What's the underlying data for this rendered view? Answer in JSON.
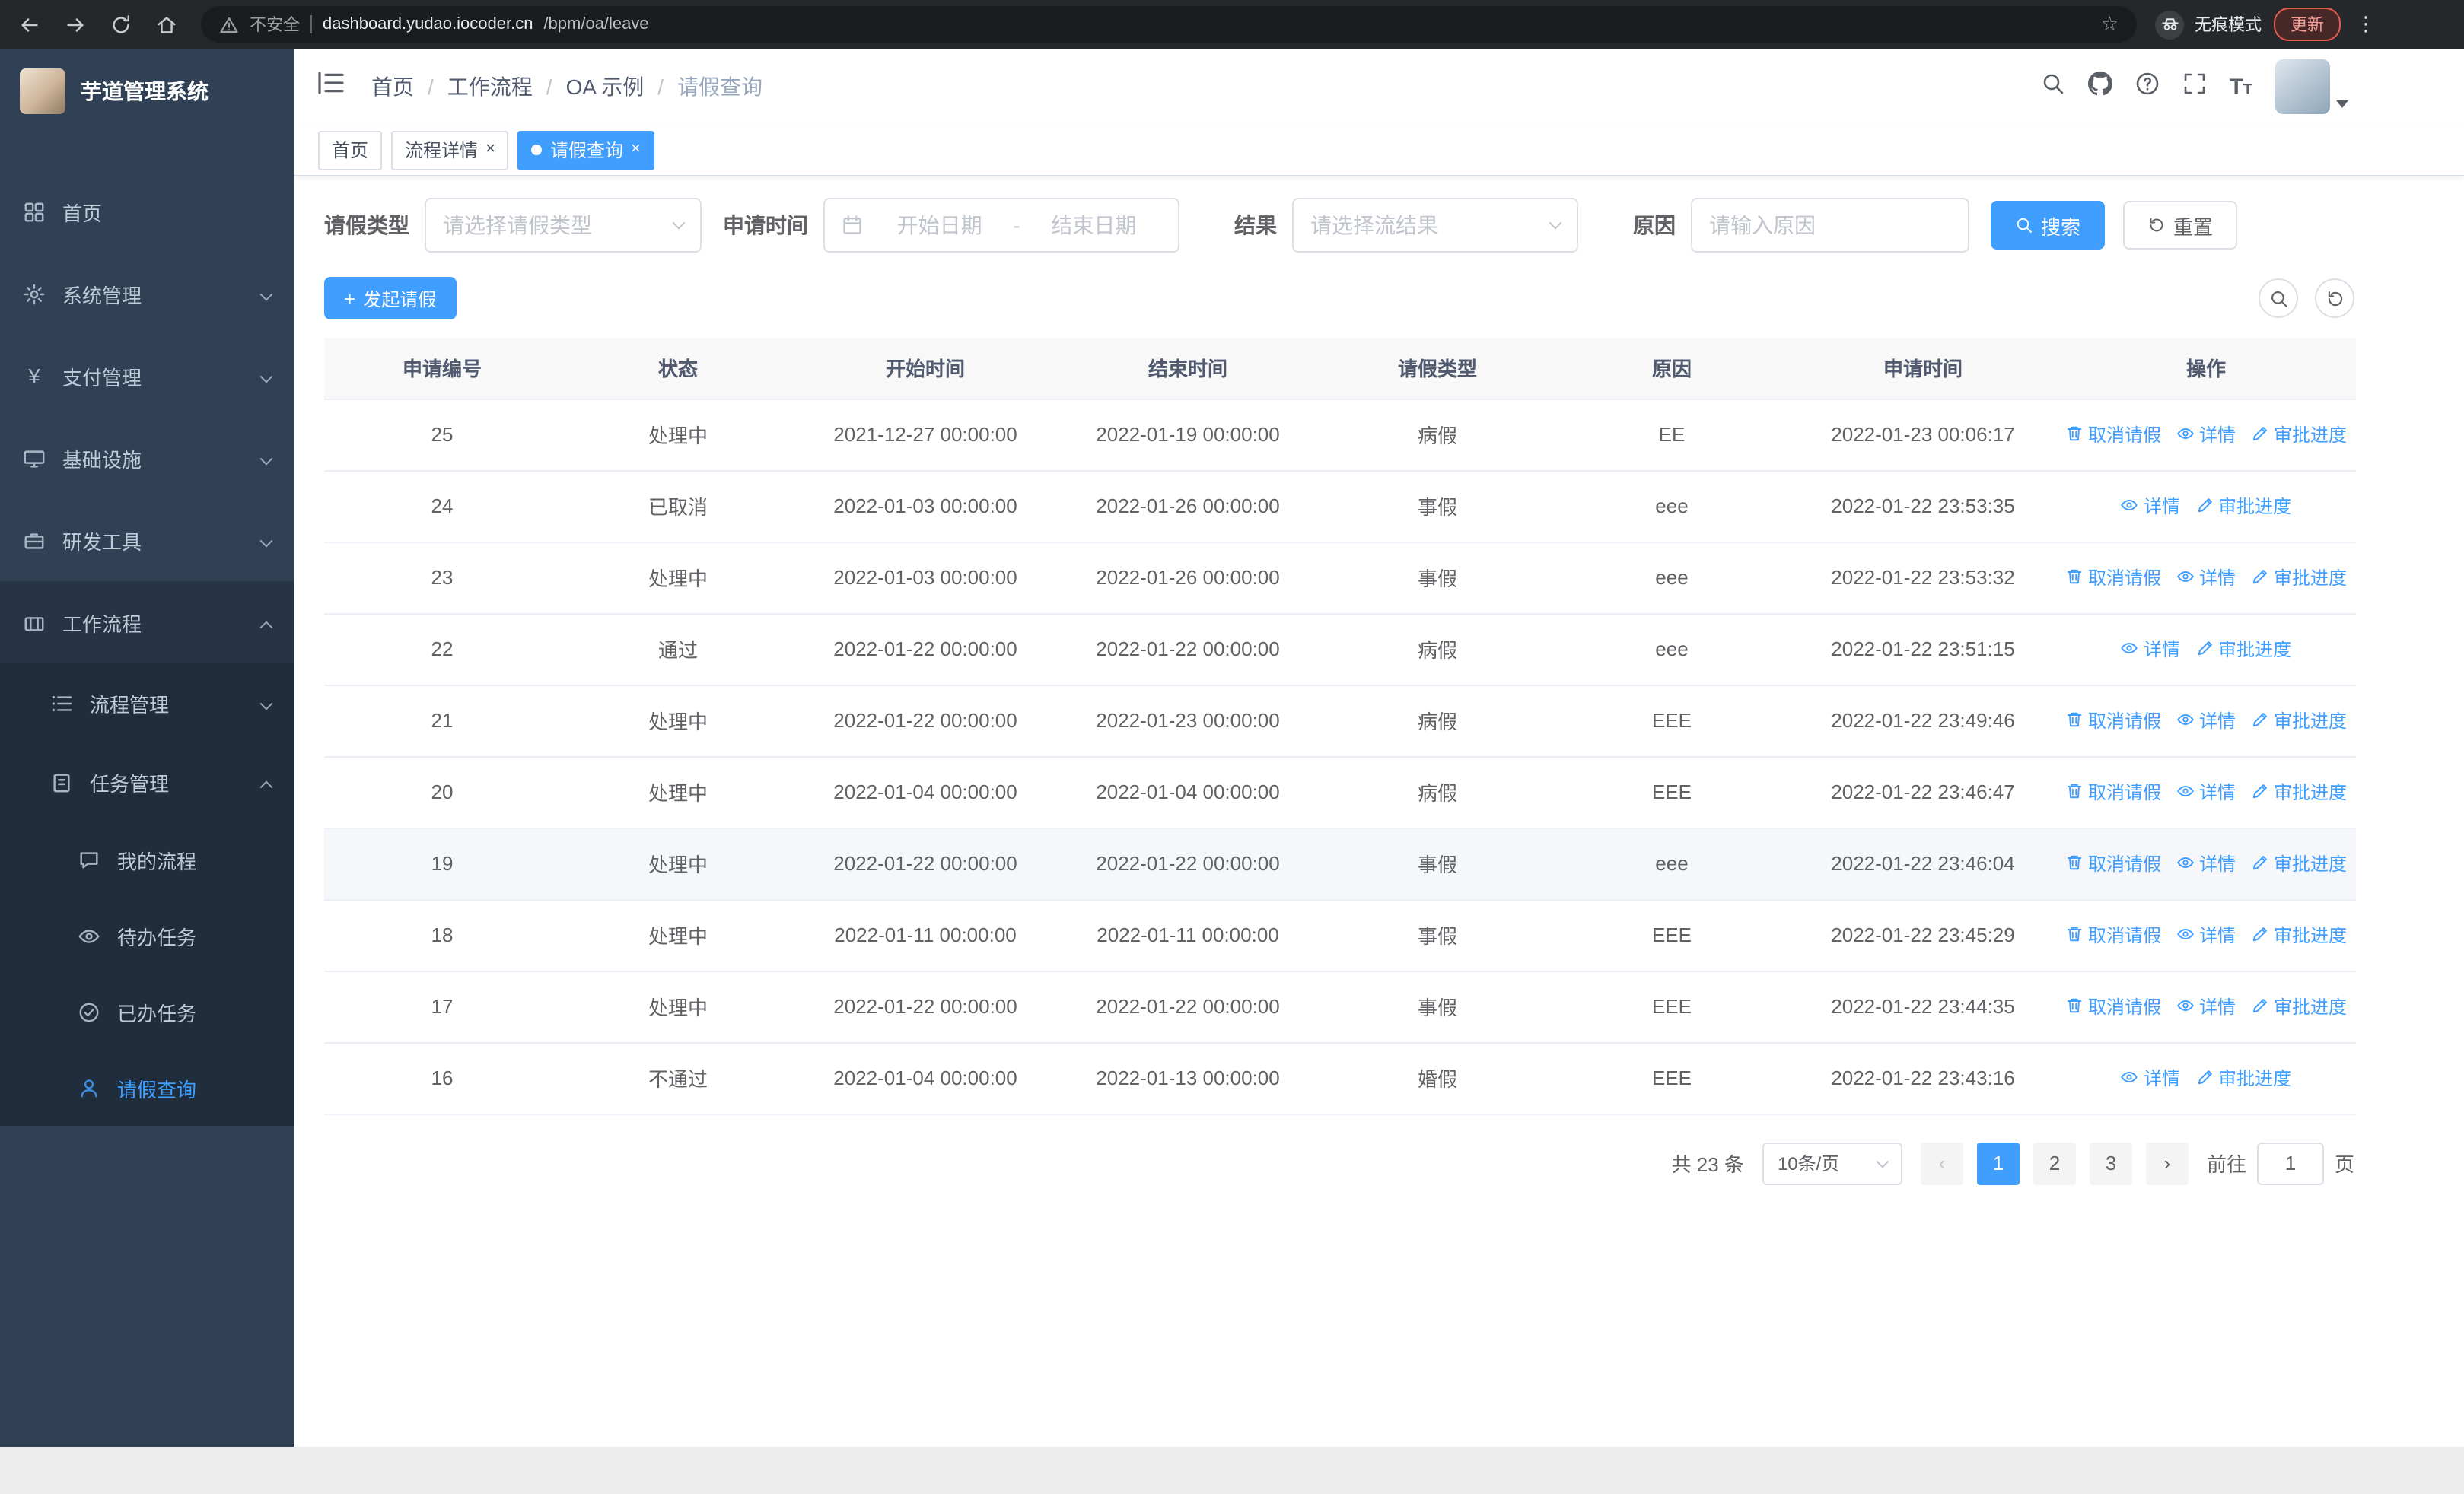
{
  "browser": {
    "security_label": "不安全",
    "url_domain": "dashboard.yudao.iocoder.cn",
    "url_path": "/bpm/oa/leave",
    "incognito_label": "无痕模式",
    "update_label": "更新"
  },
  "sidebar": {
    "app_title": "芋道管理系统",
    "items": [
      {
        "label": "首页"
      },
      {
        "label": "系统管理"
      },
      {
        "label": "支付管理"
      },
      {
        "label": "基础设施"
      },
      {
        "label": "研发工具"
      },
      {
        "label": "工作流程"
      }
    ],
    "workflow_children": [
      {
        "label": "流程管理"
      },
      {
        "label": "任务管理"
      }
    ],
    "task_children": [
      {
        "label": "我的流程"
      },
      {
        "label": "待办任务"
      },
      {
        "label": "已办任务"
      },
      {
        "label": "请假查询"
      }
    ]
  },
  "navbar": {
    "breadcrumb": [
      "首页",
      "工作流程",
      "OA 示例",
      "请假查询"
    ],
    "separator": "/"
  },
  "tabs": [
    {
      "label": "首页"
    },
    {
      "label": "流程详情"
    },
    {
      "label": "请假查询"
    }
  ],
  "filters": {
    "leave_type_label": "请假类型",
    "leave_type_placeholder": "请选择请假类型",
    "apply_time_label": "申请时间",
    "start_date_placeholder": "开始日期",
    "range_separator": "-",
    "end_date_placeholder": "结束日期",
    "result_label": "结果",
    "result_placeholder": "请选择流结果",
    "reason_label": "原因",
    "reason_placeholder": "请输入原因",
    "search_label": "搜索",
    "reset_label": "重置"
  },
  "toolbar": {
    "create_label": "发起请假"
  },
  "table": {
    "columns": [
      "申请编号",
      "状态",
      "开始时间",
      "结束时间",
      "请假类型",
      "原因",
      "申请时间",
      "操作"
    ],
    "action_labels": {
      "cancel": "取消请假",
      "detail": "详情",
      "progress": "审批进度"
    },
    "rows": [
      {
        "id": "25",
        "status": "处理中",
        "start": "2021-12-27 00:00:00",
        "end": "2022-01-19 00:00:00",
        "type": "病假",
        "reason": "EE",
        "applied": "2022-01-23 00:06:17",
        "actions": [
          "cancel",
          "detail",
          "progress"
        ]
      },
      {
        "id": "24",
        "status": "已取消",
        "start": "2022-01-03 00:00:00",
        "end": "2022-01-26 00:00:00",
        "type": "事假",
        "reason": "eee",
        "applied": "2022-01-22 23:53:35",
        "actions": [
          "detail",
          "progress"
        ]
      },
      {
        "id": "23",
        "status": "处理中",
        "start": "2022-01-03 00:00:00",
        "end": "2022-01-26 00:00:00",
        "type": "事假",
        "reason": "eee",
        "applied": "2022-01-22 23:53:32",
        "actions": [
          "cancel",
          "detail",
          "progress"
        ]
      },
      {
        "id": "22",
        "status": "通过",
        "start": "2022-01-22 00:00:00",
        "end": "2022-01-22 00:00:00",
        "type": "病假",
        "reason": "eee",
        "applied": "2022-01-22 23:51:15",
        "actions": [
          "detail",
          "progress"
        ]
      },
      {
        "id": "21",
        "status": "处理中",
        "start": "2022-01-22 00:00:00",
        "end": "2022-01-23 00:00:00",
        "type": "病假",
        "reason": "EEE",
        "applied": "2022-01-22 23:49:46",
        "actions": [
          "cancel",
          "detail",
          "progress"
        ]
      },
      {
        "id": "20",
        "status": "处理中",
        "start": "2022-01-04 00:00:00",
        "end": "2022-01-04 00:00:00",
        "type": "病假",
        "reason": "EEE",
        "applied": "2022-01-22 23:46:47",
        "actions": [
          "cancel",
          "detail",
          "progress"
        ]
      },
      {
        "id": "19",
        "status": "处理中",
        "start": "2022-01-22 00:00:00",
        "end": "2022-01-22 00:00:00",
        "type": "事假",
        "reason": "eee",
        "applied": "2022-01-22 23:46:04",
        "actions": [
          "cancel",
          "detail",
          "progress"
        ],
        "highlighted": true
      },
      {
        "id": "18",
        "status": "处理中",
        "start": "2022-01-11 00:00:00",
        "end": "2022-01-11 00:00:00",
        "type": "事假",
        "reason": "EEE",
        "applied": "2022-01-22 23:45:29",
        "actions": [
          "cancel",
          "detail",
          "progress"
        ]
      },
      {
        "id": "17",
        "status": "处理中",
        "start": "2022-01-22 00:00:00",
        "end": "2022-01-22 00:00:00",
        "type": "事假",
        "reason": "EEE",
        "applied": "2022-01-22 23:44:35",
        "actions": [
          "cancel",
          "detail",
          "progress"
        ]
      },
      {
        "id": "16",
        "status": "不通过",
        "start": "2022-01-04 00:00:00",
        "end": "2022-01-13 00:00:00",
        "type": "婚假",
        "reason": "EEE",
        "applied": "2022-01-22 23:43:16",
        "actions": [
          "detail",
          "progress"
        ]
      }
    ]
  },
  "pagination": {
    "total_label": "共 23 条",
    "page_size_label": "10条/页",
    "pages": [
      "1",
      "2",
      "3"
    ],
    "active_page": "1",
    "goto_prefix": "前往",
    "goto_value": "1",
    "goto_suffix": "页"
  }
}
